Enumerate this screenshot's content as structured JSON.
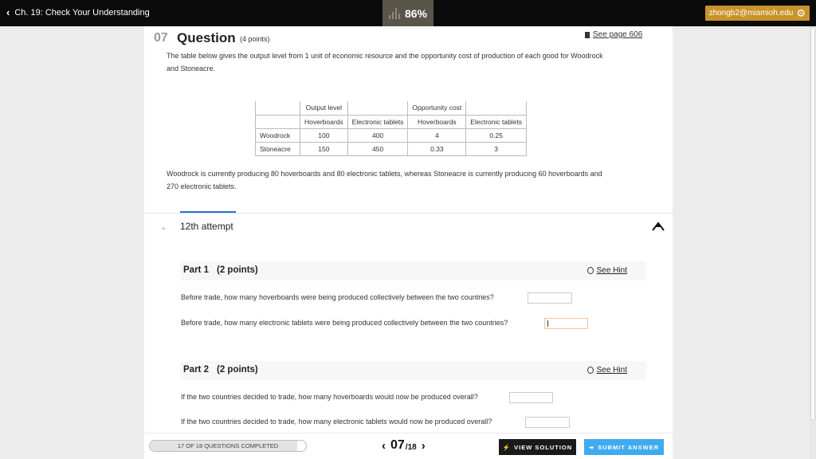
{
  "header": {
    "back_label": "Ch. 19: Check Your Understanding",
    "score": "86%",
    "user_email": "zhongb2@miamioh.edu"
  },
  "question": {
    "number": "07",
    "title": "Question",
    "points": "(4 points)",
    "see_page": "See page 606",
    "intro_line1": "The table below gives the output level from 1 unit of economic resource and the opportunity cost of production of each good for Woodrock",
    "intro_line2": "and Stoneacre.",
    "table": {
      "group_output": "Output level",
      "group_opportunity": "Opportunity cost",
      "col_hoverboards": "Hoverboards",
      "col_tablets": "Electronic tablets",
      "rows": [
        {
          "name": "Woodrock",
          "out_hover": "100",
          "out_tablets": "400",
          "opp_hover": "4",
          "opp_tablets": "0.25"
        },
        {
          "name": "Stoneacre",
          "out_hover": "150",
          "out_tablets": "450",
          "opp_hover": "0.33",
          "opp_tablets": "3"
        }
      ]
    },
    "scenario_line1": "Woodrock is currently producing 80 hoverboards and 80 electronic tablets, whereas Stoneacre is currently producing 60 hoverboards and",
    "scenario_line2": "270 electronic tablets."
  },
  "attempt": {
    "label": "12th attempt"
  },
  "parts": [
    {
      "label": "Part 1",
      "points": "(2 points)",
      "hint": "See Hint",
      "q1": "Before trade, how many hoverboards were being produced collectively between the two countries?",
      "q2": "Before trade, how many electronic tablets were being produced collectively between the two countries?"
    },
    {
      "label": "Part 2",
      "points": "(2 points)",
      "hint": "See Hint",
      "q1": "If the two countries decided to trade, how many hoverboards would now be produced overall?",
      "q2": "If the two countries decided to trade, how many electronic tablets would now be produced overall?"
    }
  ],
  "footer": {
    "progress_text": "17 OF 18 QUESTIONS COMPLETED",
    "progress_fraction": 0.944,
    "current": "07",
    "total": "/18",
    "view_solution": "VIEW SOLUTION",
    "submit": "SUBMIT ANSWER"
  },
  "colors": {
    "topbar": "#0b0b0b",
    "score_badge": "#5a5549",
    "user_badge": "#c8932a",
    "submit": "#3faaf0",
    "tab_accent": "#2a6fdb"
  }
}
